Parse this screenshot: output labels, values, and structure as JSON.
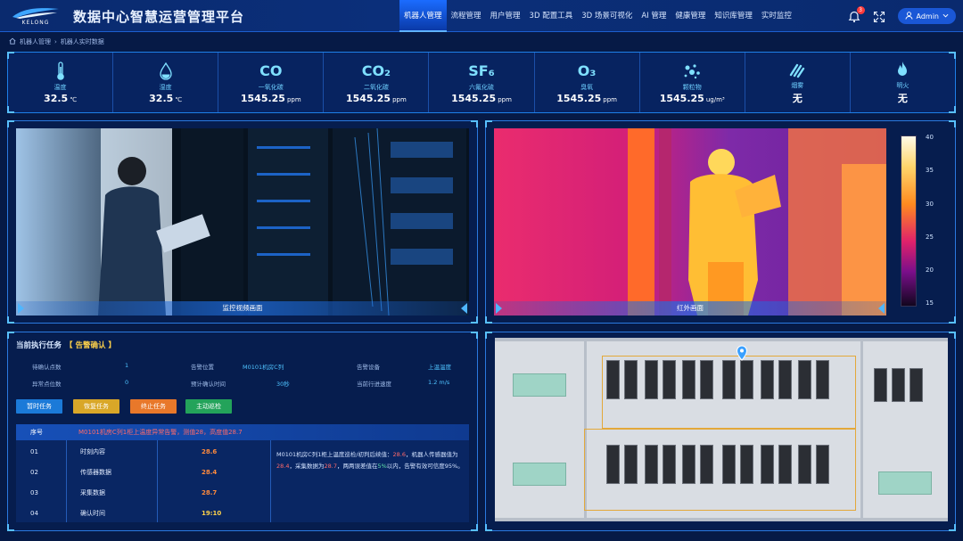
{
  "app": {
    "logo_text": "KELONG",
    "title": "数据中心智慧运营管理平台"
  },
  "nav": {
    "items": [
      "机器人管理",
      "流程管理",
      "用户管理",
      "3D 配置工具",
      "3D 场景可视化",
      "AI 管理",
      "健康管理",
      "知识库管理",
      "实时监控"
    ],
    "active_index": 0
  },
  "toolbar": {
    "notification_count": "3",
    "user_label": "Admin"
  },
  "breadcrumb": {
    "root": "机器人管理",
    "current": "机器人实时数据"
  },
  "sensors": [
    {
      "icon": "thermometer-icon",
      "name": "温度",
      "value": "32.5",
      "unit": "℃"
    },
    {
      "icon": "humidity-drop-icon",
      "name": "湿度",
      "value": "32.5",
      "unit": "℃"
    },
    {
      "icon_text": "CO",
      "name": "一氧化碳",
      "value": "1545.25",
      "unit": "ppm"
    },
    {
      "icon_text": "CO₂",
      "name": "二氧化碳",
      "value": "1545.25",
      "unit": "ppm"
    },
    {
      "icon_text": "SF₆",
      "name": "六氟化硫",
      "value": "1545.25",
      "unit": "ppm"
    },
    {
      "icon_text": "O₃",
      "name": "臭氧",
      "value": "1545.25",
      "unit": "ppm"
    },
    {
      "icon": "particles-icon",
      "name": "颗粒物",
      "value": "1545.25",
      "unit": "ug/m³"
    },
    {
      "icon": "smoke-icon",
      "name": "烟雾",
      "value": "无",
      "unit": ""
    },
    {
      "icon": "flame-icon",
      "name": "明火",
      "value": "无",
      "unit": ""
    }
  ],
  "video": {
    "caption": "监控视频画面"
  },
  "thermal": {
    "caption": "红外画面",
    "scale_labels": [
      "40",
      "35",
      "30",
      "25",
      "20",
      "15"
    ]
  },
  "task": {
    "title": "当前执行任务",
    "status": "【 告警确认 】",
    "fields": [
      {
        "k": "待确认点数",
        "v": "1"
      },
      {
        "k": "告警位置",
        "v": "M0101机房C列"
      },
      {
        "k": "告警设备",
        "v": "上温温度"
      },
      {
        "k": "异常点位数",
        "v": "0"
      },
      {
        "k": "预计确认时间",
        "v": "30秒"
      },
      {
        "k": "当前行进速度",
        "v": "1.2 m/s"
      }
    ],
    "buttons": [
      {
        "label": "暂时任务",
        "color": "#1b7ad8"
      },
      {
        "label": "恢复任务",
        "color": "#d9a728"
      },
      {
        "label": "终止任务",
        "color": "#e8782a"
      },
      {
        "label": "主动巡检",
        "color": "#23a35a"
      }
    ],
    "table_header": {
      "no": "序号",
      "alert": "M0101机房C列1柜上温度异常告警，测值28，高度值28.7"
    },
    "rows": [
      {
        "no": "01",
        "name": "时刻内容",
        "value": "28.6"
      },
      {
        "no": "02",
        "name": "传感器数据",
        "value": "28.4"
      },
      {
        "no": "03",
        "name": "采集数据",
        "value": "28.7"
      },
      {
        "no": "04",
        "name": "确认时间",
        "value": "19:10"
      }
    ],
    "description": {
      "p1": "M0101机房C列1柜上温度巡检/初判后续值：",
      "v1": "28.6",
      "p2": "，机器人传感器值为",
      "v2": "28.4",
      "p3": "，采集数据为",
      "v3": "28.7",
      "p4": "，两两误差值在",
      "v4": "5%",
      "p5": "以内，告警有效可信度95%。"
    }
  }
}
